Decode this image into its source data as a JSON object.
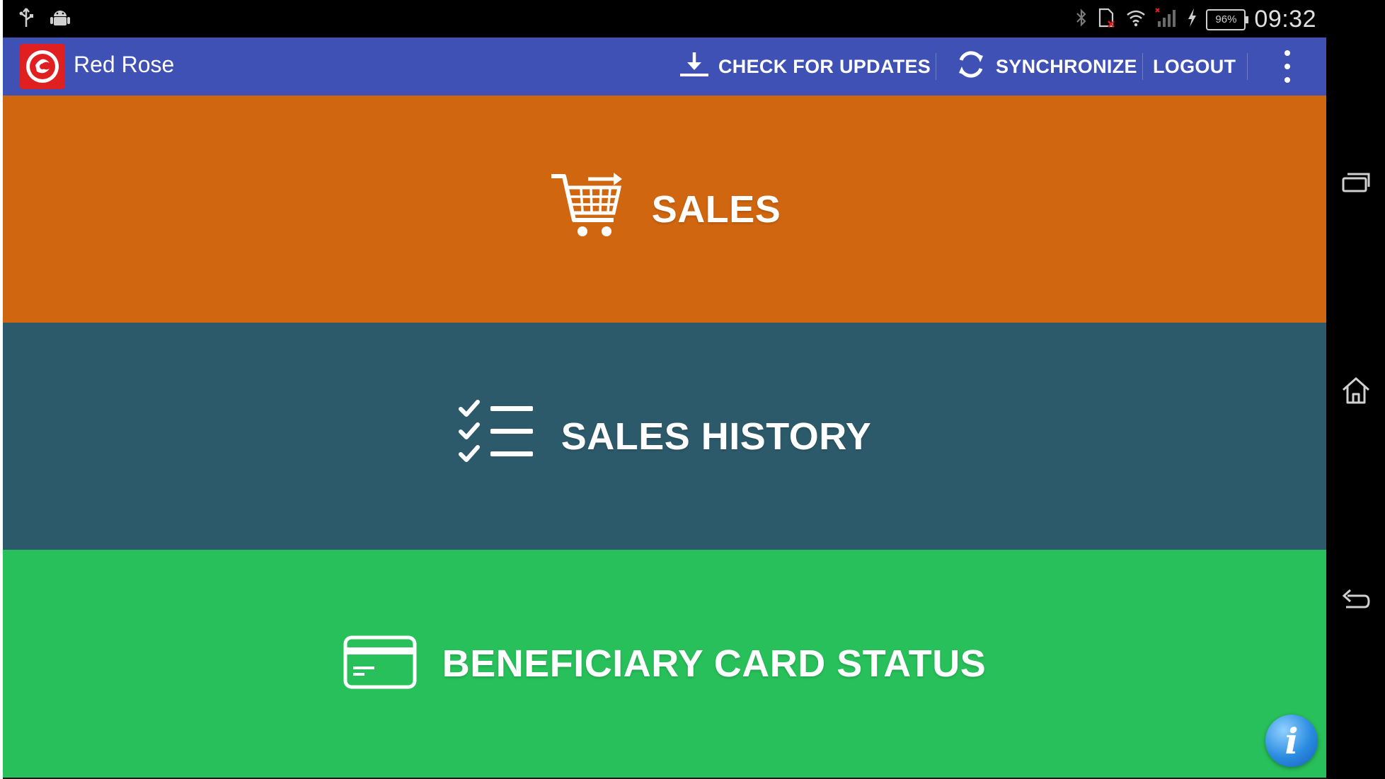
{
  "status_bar": {
    "time": "09:32",
    "battery": "96%"
  },
  "action_bar": {
    "app_title": "Red Rose",
    "check_updates_label": "CHECK FOR UPDATES",
    "synchronize_label": "SYNCHRONIZE",
    "logout_label": "LOGOUT"
  },
  "tiles": [
    {
      "label": "SALES",
      "icon": "shopping-cart-icon",
      "color": "#d06610"
    },
    {
      "label": "SALES HISTORY",
      "icon": "checklist-icon",
      "color": "#2d5a6b"
    },
    {
      "label": "BENEFICIARY CARD STATUS",
      "icon": "credit-card-icon",
      "color": "#28c05a"
    }
  ],
  "info_button": {
    "label": "i"
  },
  "colors": {
    "action_bar": "#3f51b5",
    "logo": "#e02020"
  }
}
